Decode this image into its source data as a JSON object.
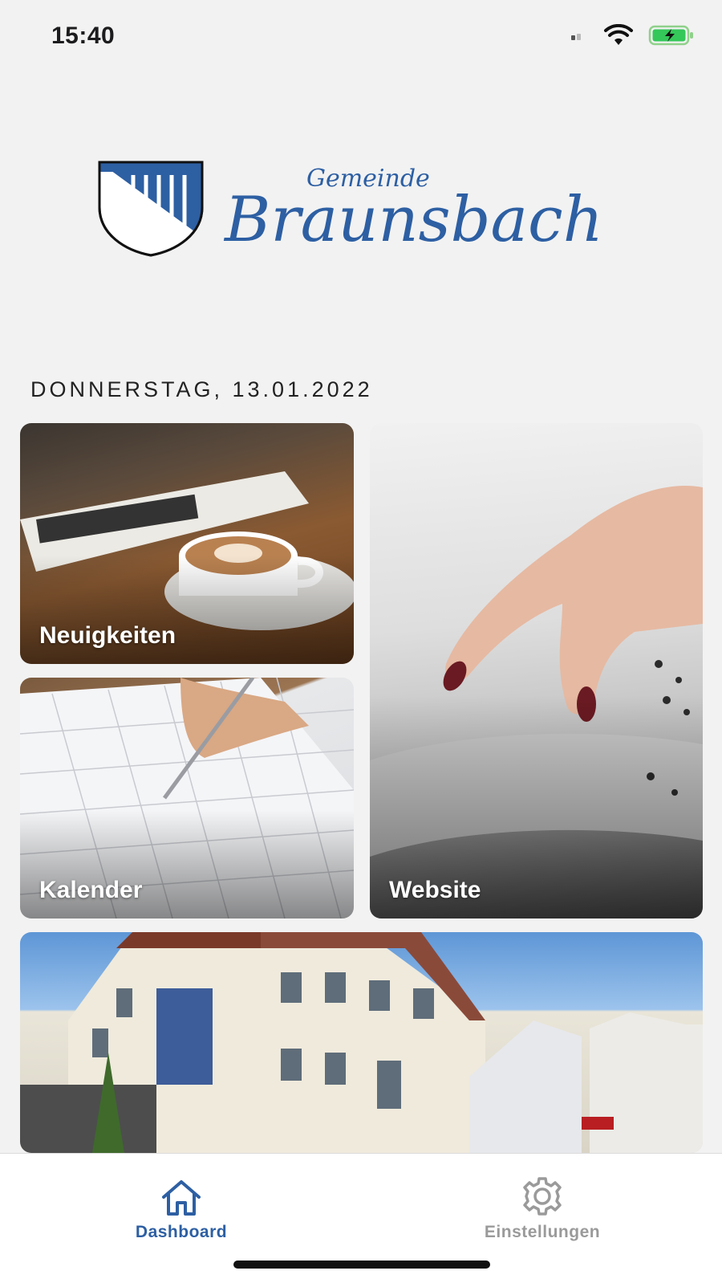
{
  "status_bar": {
    "time": "15:40",
    "icons": [
      "signal-icon",
      "wifi-icon",
      "battery-charging-icon"
    ]
  },
  "logo": {
    "prefix": "Gemeinde",
    "name": "Braunsbach",
    "brand_color": "#2d5fa3"
  },
  "date_label": "DONNERSTAG, 13.01.2022",
  "tiles": [
    {
      "label": "Neuigkeiten",
      "image": "coffee-and-newspaper-photo"
    },
    {
      "label": "Kalender",
      "image": "calendar-and-pen-photo"
    },
    {
      "label": "Website",
      "image": "finger-on-tablet-photo"
    },
    {
      "label": "",
      "image": "town-hall-building-photo"
    }
  ],
  "tabbar": {
    "tabs": [
      {
        "label": "Dashboard",
        "icon": "home-icon",
        "active": true,
        "color": "#2d5fa3"
      },
      {
        "label": "Einstellungen",
        "icon": "gear-icon",
        "active": false,
        "color": "#9a9a9a"
      }
    ]
  }
}
